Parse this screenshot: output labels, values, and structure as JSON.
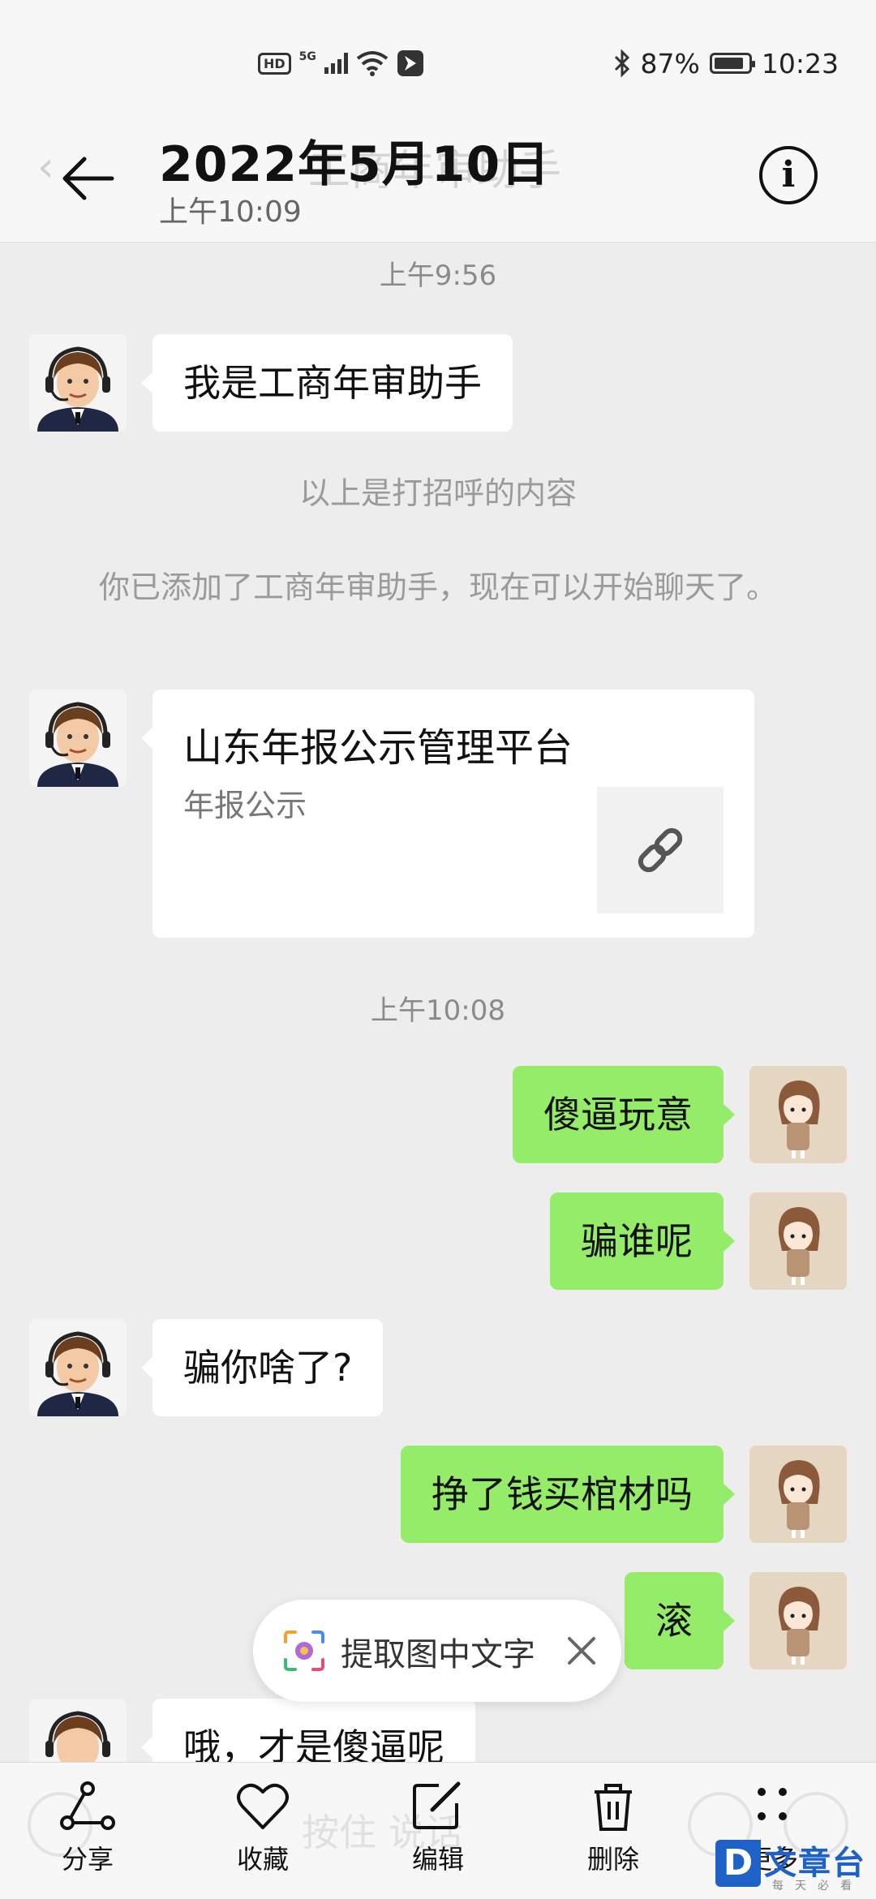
{
  "status_bar": {
    "hd": "HD",
    "network": "5G",
    "battery": "87%",
    "battery_level": 0.87,
    "time": "10:23"
  },
  "header": {
    "title": "2022年5月10日",
    "subtitle": "上午10:09",
    "background_title": "工商年审助手"
  },
  "chat": {
    "time_1": "上午9:56",
    "msg_1": "我是工商年审助手",
    "sys_1": "以上是打招呼的内容",
    "sys_2": "你已添加了工商年审助手，现在可以开始聊天了。",
    "link_card": {
      "title": "山东年报公示管理平台",
      "desc": "年报公示"
    },
    "time_2": "上午10:08",
    "msg_2": "傻逼玩意",
    "msg_3": "骗谁呢",
    "msg_4": "骗你啥了?",
    "msg_5": "挣了钱买棺材吗",
    "msg_6": "滚",
    "msg_7": "哦，才是傻逼呢"
  },
  "ocr_popup": {
    "label": "提取图中文字"
  },
  "bottom_bar": {
    "hint": "按住 说话",
    "share": "分享",
    "favorite": "收藏",
    "edit": "编辑",
    "delete": "删除",
    "more": "更多"
  },
  "watermark": {
    "logo": "D",
    "text": "文章台",
    "sub": "每天必看"
  },
  "colors": {
    "background": "#ededed",
    "bubble_self": "#95ec69",
    "bubble_other": "#ffffff",
    "watermark_blue": "#1e62c8"
  }
}
